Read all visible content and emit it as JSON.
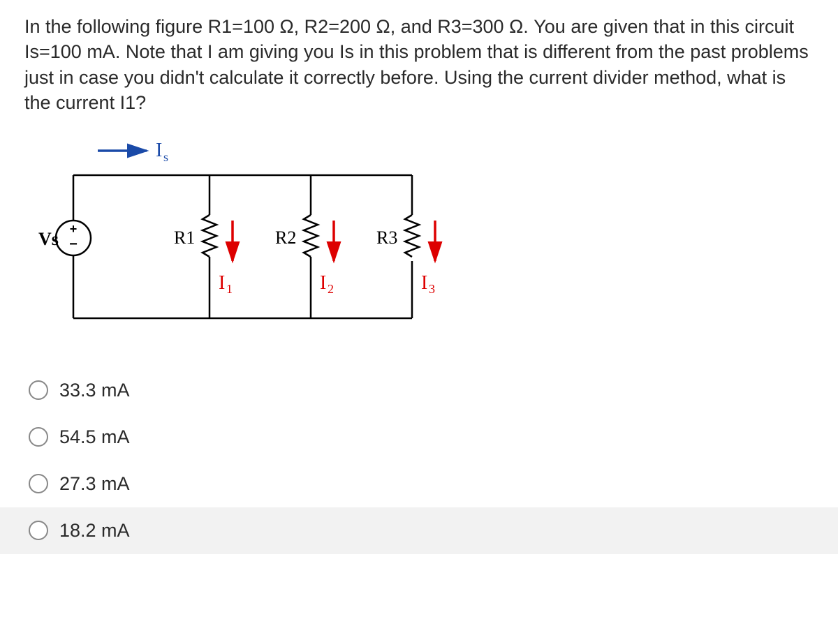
{
  "question": "In the following figure R1=100 Ω, R2=200 Ω, and R3=300 Ω.  You are given that in this circuit Is=100 mA.  Note that I am giving you Is in this problem that is different from the past problems just in case you didn't calculate it correctly before.  Using the current divider method, what is the current I1?",
  "circuit": {
    "source_label": "Vs",
    "source_current": "Is",
    "resistors": [
      "R1",
      "R2",
      "R3"
    ],
    "branch_currents": [
      "I₁",
      "I₂",
      "I₃"
    ],
    "given": {
      "R1_ohm": 100,
      "R2_ohm": 200,
      "R3_ohm": 300,
      "Is_mA": 100
    }
  },
  "options": [
    {
      "label": "33.3 mA"
    },
    {
      "label": "54.5 mA"
    },
    {
      "label": "27.3 mA"
    },
    {
      "label": "18.2 mA"
    }
  ]
}
